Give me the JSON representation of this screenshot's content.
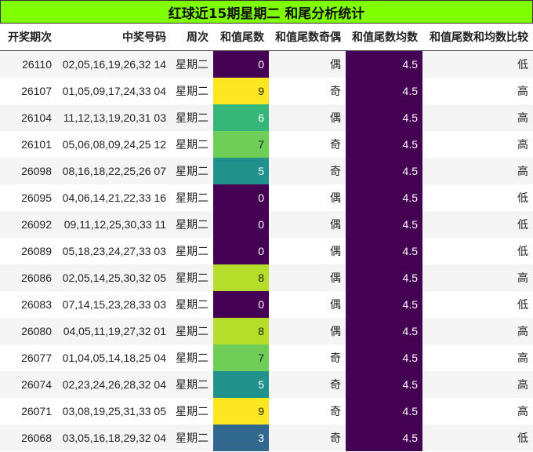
{
  "title": "红球近15期星期二 和尾分析统计",
  "columns": [
    "开奖期次",
    "中奖号码",
    "周次",
    "和值尾数",
    "和值尾数奇偶",
    "和值尾数均数",
    "和值尾数和均数比较"
  ],
  "colors": {
    "title_bg": "#7fff00",
    "avg_bg": "#440154",
    "tail_scale": {
      "0": "#440154",
      "3": "#31688e",
      "5": "#21918c",
      "6": "#35b779",
      "7": "#6ece58",
      "8": "#b5de2b",
      "9": "#fde725"
    }
  },
  "rows": [
    {
      "issue": "26110",
      "numbers": "02,05,16,19,26,32 14",
      "weekday": "星期二",
      "tail": "0",
      "parity": "偶",
      "avg": "4.5",
      "compare": "低"
    },
    {
      "issue": "26107",
      "numbers": "01,05,09,17,24,33 04",
      "weekday": "星期二",
      "tail": "9",
      "parity": "奇",
      "avg": "4.5",
      "compare": "高"
    },
    {
      "issue": "26104",
      "numbers": "11,12,13,19,20,31 03",
      "weekday": "星期二",
      "tail": "6",
      "parity": "偶",
      "avg": "4.5",
      "compare": "高"
    },
    {
      "issue": "26101",
      "numbers": "05,06,08,09,24,25 12",
      "weekday": "星期二",
      "tail": "7",
      "parity": "奇",
      "avg": "4.5",
      "compare": "高"
    },
    {
      "issue": "26098",
      "numbers": "08,16,18,22,25,26 07",
      "weekday": "星期二",
      "tail": "5",
      "parity": "奇",
      "avg": "4.5",
      "compare": "高"
    },
    {
      "issue": "26095",
      "numbers": "04,06,14,21,22,33 16",
      "weekday": "星期二",
      "tail": "0",
      "parity": "偶",
      "avg": "4.5",
      "compare": "低"
    },
    {
      "issue": "26092",
      "numbers": "09,11,12,25,30,33 11",
      "weekday": "星期二",
      "tail": "0",
      "parity": "偶",
      "avg": "4.5",
      "compare": "低"
    },
    {
      "issue": "26089",
      "numbers": "05,18,23,24,27,33 03",
      "weekday": "星期二",
      "tail": "0",
      "parity": "偶",
      "avg": "4.5",
      "compare": "低"
    },
    {
      "issue": "26086",
      "numbers": "02,05,14,25,30,32 05",
      "weekday": "星期二",
      "tail": "8",
      "parity": "偶",
      "avg": "4.5",
      "compare": "高"
    },
    {
      "issue": "26083",
      "numbers": "07,14,15,23,28,33 03",
      "weekday": "星期二",
      "tail": "0",
      "parity": "偶",
      "avg": "4.5",
      "compare": "低"
    },
    {
      "issue": "26080",
      "numbers": "04,05,11,19,27,32 01",
      "weekday": "星期二",
      "tail": "8",
      "parity": "偶",
      "avg": "4.5",
      "compare": "高"
    },
    {
      "issue": "26077",
      "numbers": "01,04,05,14,18,25 04",
      "weekday": "星期二",
      "tail": "7",
      "parity": "奇",
      "avg": "4.5",
      "compare": "高"
    },
    {
      "issue": "26074",
      "numbers": "02,23,24,26,28,32 04",
      "weekday": "星期二",
      "tail": "5",
      "parity": "奇",
      "avg": "4.5",
      "compare": "高"
    },
    {
      "issue": "26071",
      "numbers": "03,08,19,25,31,33 05",
      "weekday": "星期二",
      "tail": "9",
      "parity": "奇",
      "avg": "4.5",
      "compare": "高"
    },
    {
      "issue": "26068",
      "numbers": "03,05,16,18,29,32 04",
      "weekday": "星期二",
      "tail": "3",
      "parity": "奇",
      "avg": "4.5",
      "compare": "低"
    }
  ]
}
